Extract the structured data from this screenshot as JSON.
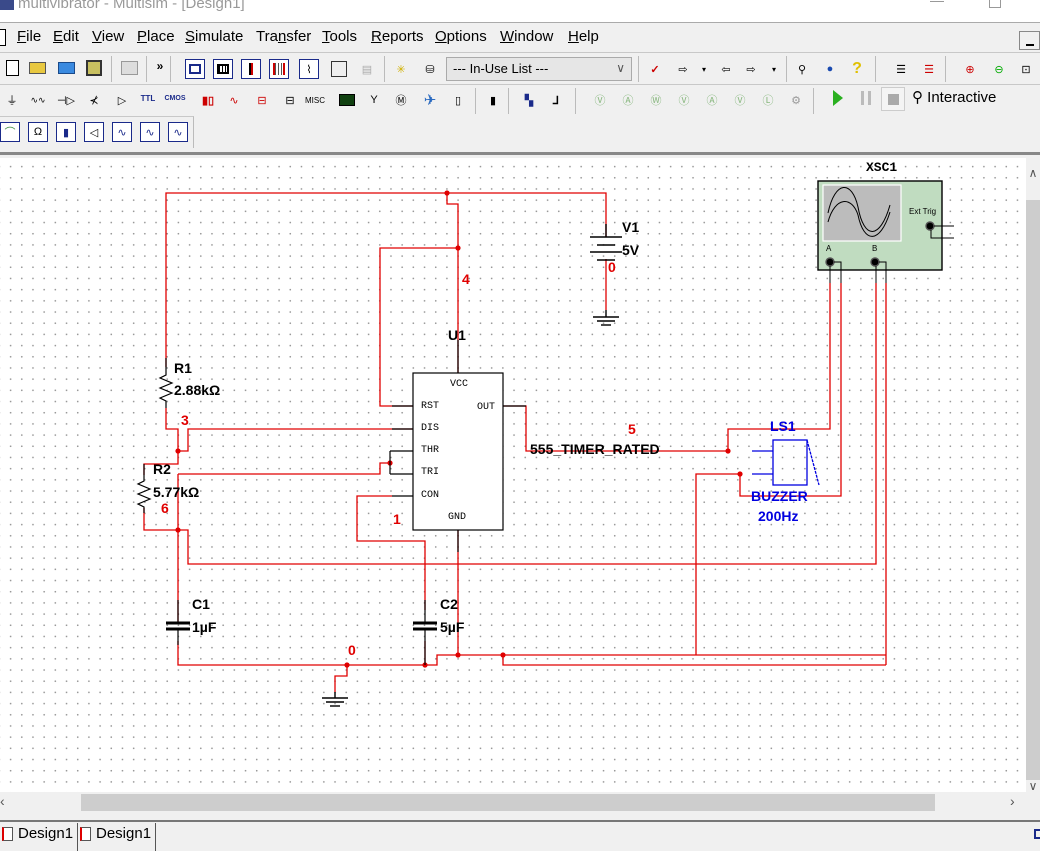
{
  "window": {
    "title": "multivibrator - Multisim - [Design1]"
  },
  "menu": {
    "items": [
      {
        "label": "File",
        "accel": "F"
      },
      {
        "label": "Edit",
        "accel": "E"
      },
      {
        "label": "View",
        "accel": "V"
      },
      {
        "label": "Place",
        "accel": "P"
      },
      {
        "label": "Simulate",
        "accel": "S"
      },
      {
        "label": "Transfer",
        "accel": "n"
      },
      {
        "label": "Tools",
        "accel": "T"
      },
      {
        "label": "Reports",
        "accel": "R"
      },
      {
        "label": "Options",
        "accel": "O"
      },
      {
        "label": "Window",
        "accel": "W"
      },
      {
        "label": "Help",
        "accel": "H"
      }
    ]
  },
  "toolbar": {
    "in_use_list": "--- In-Use List ---",
    "overflow_label": "»",
    "misc_label": "MISC",
    "ttl_label": "TTL",
    "cmos_label": "CMOS",
    "simulation_mode": "Interactive",
    "icons_row1": [
      "new-icon",
      "open-sample-icon",
      "open-icon",
      "save-icon",
      "print-icon",
      "overflow-icon",
      "design-toolbox-icon",
      "spreadsheet-icon",
      "sim-params-icon",
      "breadboard-icon",
      "grapher-icon",
      "postprocessor-icon",
      "component-wizard-icon",
      "database-manager-icon",
      "in-use-list-dropdown",
      "erc-icon",
      "transfer-to-pcb-icon",
      "backannotate-icon",
      "forward-annotate-icon",
      "find-examples-icon",
      "ni-website-icon",
      "help-icon",
      "bus-vector-icon",
      "bus-connect-icon",
      "zoom-in-icon",
      "zoom-out-icon",
      "zoom-area-icon"
    ],
    "icons_row2": [
      "power-source-icon",
      "basic-component-icon",
      "diode-icon",
      "transistor-icon",
      "analog-icon",
      "ttl-icon",
      "cmos-icon",
      "mcu-digital-icon",
      "mixed-icon",
      "indicator-icon",
      "power-component-icon",
      "misc-icon",
      "advanced-peripherals-icon",
      "rf-icon",
      "electromechanical-icon",
      "ni-components-icon",
      "connector-icon",
      "mcu-icon",
      "hierarchical-block-icon",
      "bus-icon",
      "voltmeter-probe-icon",
      "ammeter-probe-icon",
      "wattmeter-probe-icon",
      "differential-voltage-probe-icon",
      "current-voltage-probe-icon",
      "reference-probe-icon",
      "digital-probe-icon",
      "probe-settings-icon",
      "run-icon",
      "pause-icon",
      "stop-icon"
    ],
    "icons_row3": [
      "analysis-icon",
      "multimeter-icon",
      "function-generator-icon",
      "wattmeter-icon",
      "oscilloscope-icon",
      "bode-plotter-icon",
      "frequency-counter-icon"
    ]
  },
  "schematic": {
    "components": {
      "V1": {
        "ref": "V1",
        "value": "5V"
      },
      "U1": {
        "ref": "U1",
        "part": "555_TIMER_RATED",
        "pins": [
          "VCC",
          "RST",
          "OUT",
          "DIS",
          "THR",
          "TRI",
          "CON",
          "GND"
        ]
      },
      "R1": {
        "ref": "R1",
        "value": "2.88kΩ"
      },
      "R2": {
        "ref": "R2",
        "value": "5.77kΩ"
      },
      "C1": {
        "ref": "C1",
        "value": "1µF"
      },
      "C2": {
        "ref": "C2",
        "value": "5µF"
      },
      "LS1": {
        "ref": "LS1",
        "type": "BUZZER",
        "value": "200Hz"
      },
      "XSC1": {
        "ref": "XSC1",
        "ext_trig": "Ext Trig",
        "ch_a": "A",
        "ch_b": "B"
      }
    },
    "nets": [
      "0",
      "1",
      "3",
      "4",
      "5",
      "6",
      "0"
    ],
    "colors": {
      "wire": "#e00000",
      "component": "#000000",
      "buzzer": "#0000e0",
      "scope_body": "#c0dcc0"
    }
  },
  "tabs": [
    {
      "label": "Design1"
    },
    {
      "label": "Design1"
    }
  ]
}
